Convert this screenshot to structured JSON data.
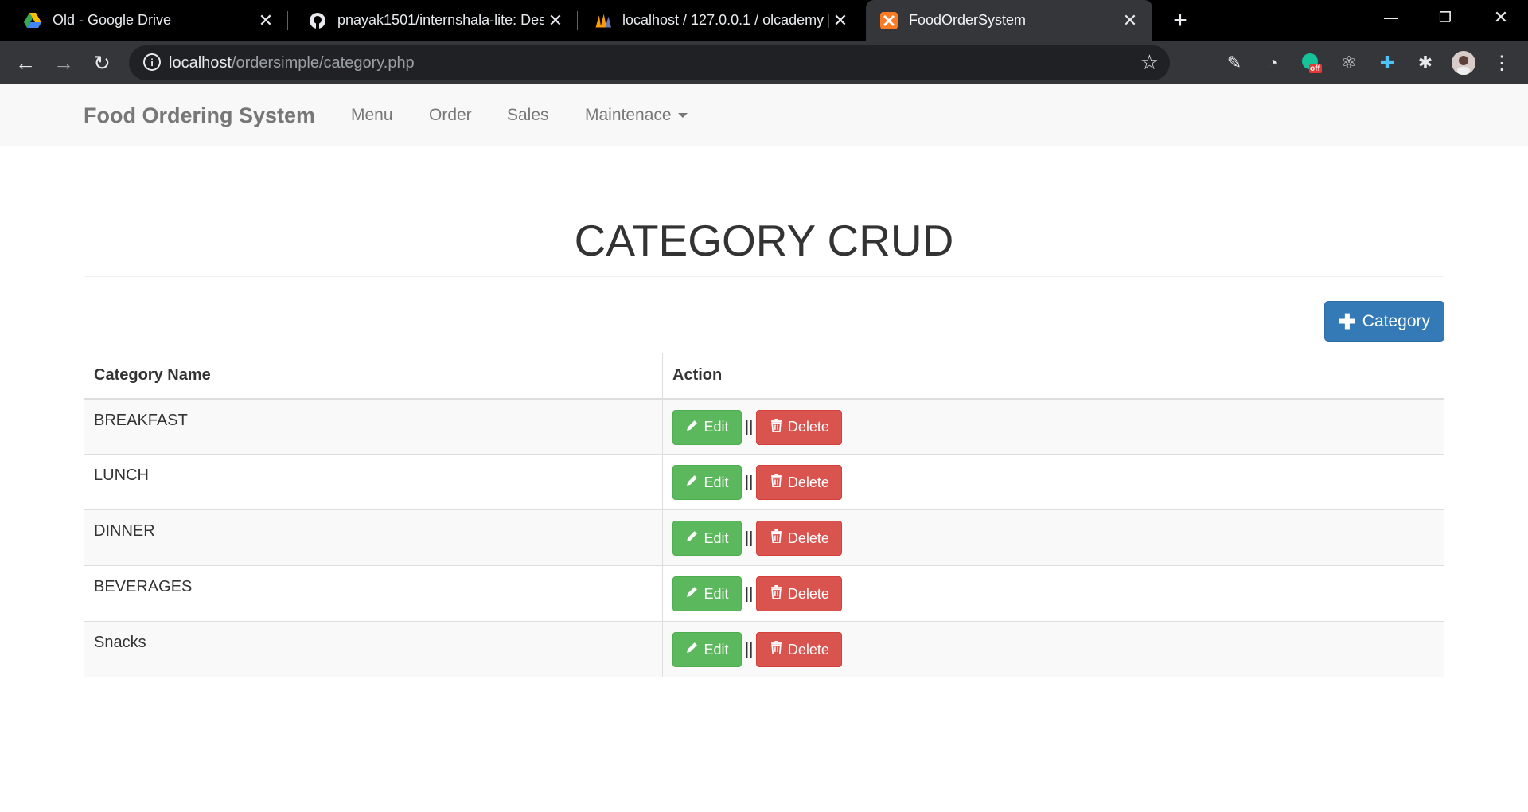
{
  "browser": {
    "tabs": [
      {
        "title": "Old - Google Drive",
        "icon": "google-drive-icon"
      },
      {
        "title": "pnayak1501/internshala-lite: Desi",
        "icon": "github-icon"
      },
      {
        "title": "localhost / 127.0.0.1 / olcademy |",
        "icon": "phpmyadmin-icon"
      },
      {
        "title": "FoodOrderSystem",
        "icon": "xampp-icon",
        "active": true
      }
    ],
    "url_host": "localhost",
    "url_path": "/ordersimple/category.php",
    "extension_badge": "off"
  },
  "navbar": {
    "brand": "Food Ordering System",
    "links": [
      "Menu",
      "Order",
      "Sales",
      "Maintenace"
    ]
  },
  "page": {
    "title": "CATEGORY CRUD",
    "add_button_label": "Category"
  },
  "table": {
    "headers": [
      "Category Name",
      "Action"
    ],
    "rows": [
      {
        "name": "BREAKFAST"
      },
      {
        "name": "LUNCH"
      },
      {
        "name": "DINNER"
      },
      {
        "name": "BEVERAGES"
      },
      {
        "name": "Snacks"
      }
    ],
    "edit_label": "Edit",
    "delete_label": "Delete",
    "separator": "||"
  },
  "colors": {
    "primary": "#337ab7",
    "success": "#5cb85c",
    "danger": "#d9534f"
  }
}
